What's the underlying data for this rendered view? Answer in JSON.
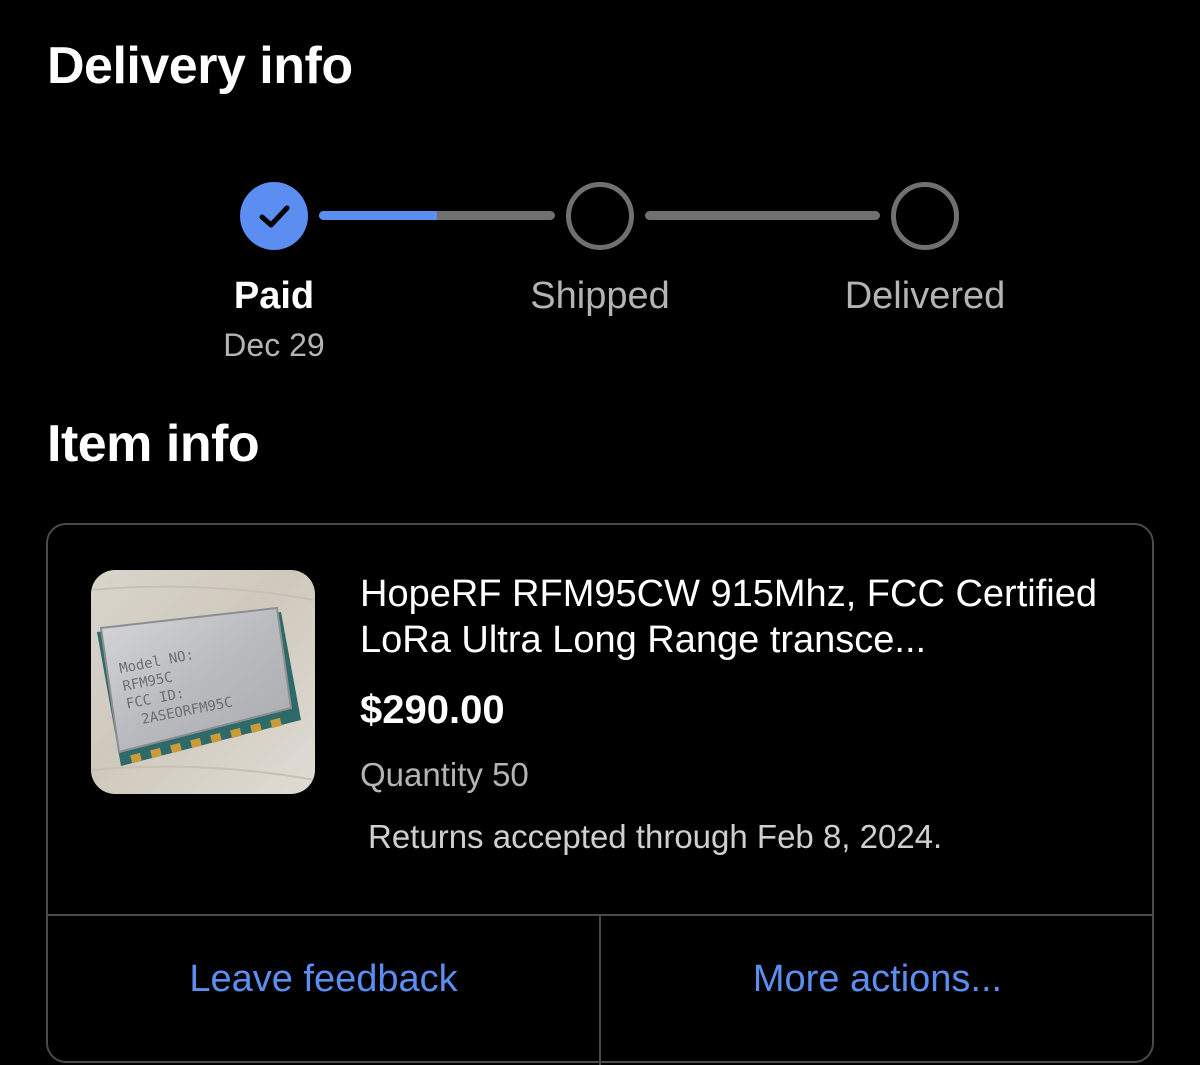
{
  "delivery": {
    "title": "Delivery info",
    "steps": [
      {
        "label": "Paid",
        "date": "Dec 29",
        "status": "complete"
      },
      {
        "label": "Shipped",
        "status": "pending"
      },
      {
        "label": "Delivered",
        "status": "pending"
      }
    ],
    "progress_to_shipped_fraction": 0.5
  },
  "item_info": {
    "title": "Item info",
    "item": {
      "title": "HopeRF RFM95CW 915Mhz, FCC Certified LoRa Ultra Long Range transce...",
      "price": "$290.00",
      "quantity": "Quantity 50",
      "returns": "Returns accepted through Feb 8, 2024.",
      "image_lettering": [
        "Model NO:",
        "RFM95C",
        "FCC ID:",
        "2ASEORFM95C"
      ]
    },
    "actions": {
      "leave_feedback": "Leave feedback",
      "more_actions": "More actions..."
    }
  },
  "colors": {
    "background": "#000000",
    "accent": "#5b8ef0",
    "track_inactive": "#707070",
    "border": "#4a4a4a",
    "text_secondary": "#b4b4b4"
  },
  "icons": {
    "paid_step": "checkmark-icon"
  }
}
